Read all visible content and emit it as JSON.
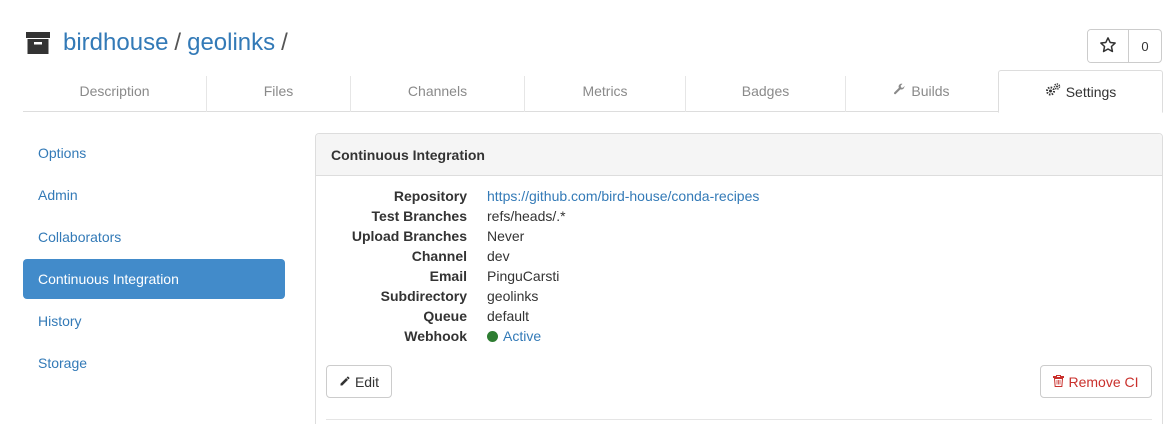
{
  "header": {
    "owner": "birdhouse",
    "separator": "/",
    "repo": "geolinks",
    "trailing_separator": "/",
    "repo_icon": "archive-box-icon",
    "star_icon": "star-outline-icon",
    "star_count": "0"
  },
  "tabs": [
    {
      "label": "Description"
    },
    {
      "label": "Files"
    },
    {
      "label": "Channels"
    },
    {
      "label": "Metrics"
    },
    {
      "label": "Badges"
    },
    {
      "label": "Builds",
      "icon": "wrench-icon"
    },
    {
      "label": "Settings",
      "icon": "gears-icon",
      "active": true
    }
  ],
  "sidebar": {
    "items": [
      {
        "label": "Options"
      },
      {
        "label": "Admin"
      },
      {
        "label": "Collaborators"
      },
      {
        "label": "Continuous Integration",
        "active": true
      },
      {
        "label": "History"
      },
      {
        "label": "Storage"
      }
    ]
  },
  "panel": {
    "title": "Continuous Integration",
    "rows": [
      {
        "key": "Repository",
        "value": "https://github.com/bird-house/conda-recipes",
        "link": true
      },
      {
        "key": "Test Branches",
        "value": "refs/heads/.*"
      },
      {
        "key": "Upload Branches",
        "value": "Never"
      },
      {
        "key": "Channel",
        "value": "dev"
      },
      {
        "key": "Email",
        "value": "PinguCarsti"
      },
      {
        "key": "Subdirectory",
        "value": "geolinks"
      },
      {
        "key": "Queue",
        "value": "default"
      },
      {
        "key": "Webhook",
        "value": "Active",
        "link": true,
        "status_color": "#2e7d32"
      }
    ],
    "edit_label": "Edit",
    "edit_icon": "pencil-icon",
    "remove_label": "Remove CI",
    "remove_icon": "trash-icon"
  },
  "colors": {
    "link": "#337ab7",
    "active_nav": "#428bca",
    "danger": "#c9302c"
  }
}
